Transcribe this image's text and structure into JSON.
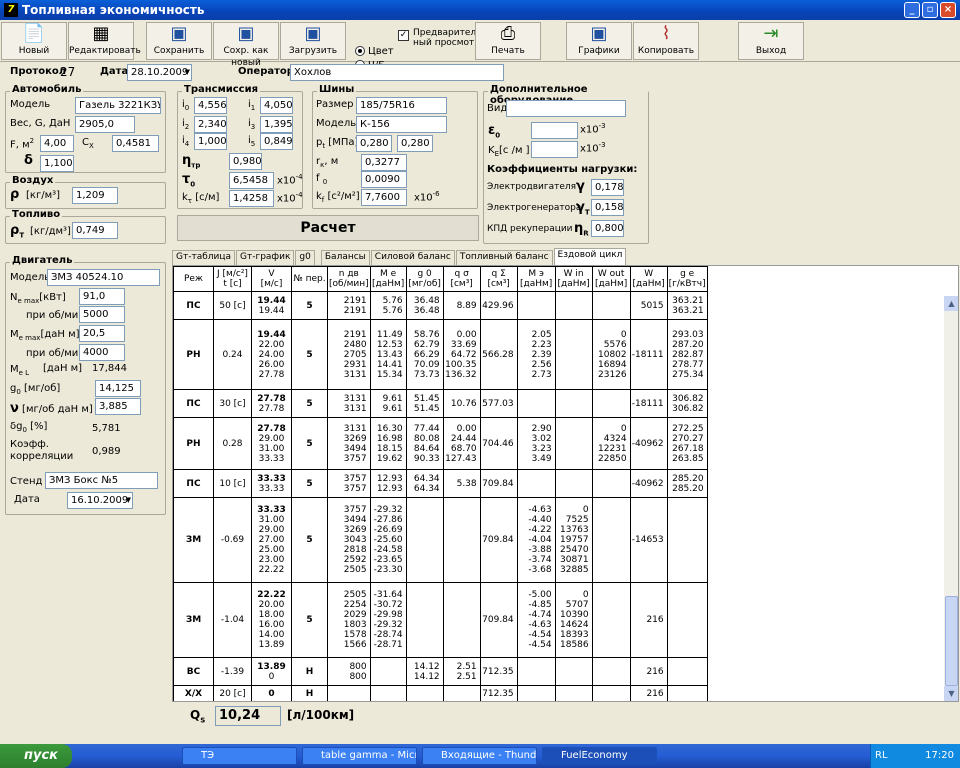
{
  "window": {
    "title": "Топливная экономичность"
  },
  "toolbar": {
    "new": "Новый",
    "edit": "Редактировать",
    "save": "Сохранить",
    "save_as": "Сохр. как новый",
    "load": "Загрузить",
    "color": "Цвет",
    "bw": "Ч/Б",
    "preview1": "Предваритель",
    "preview2": "ный просмотр",
    "print": "Печать",
    "charts": "Графики",
    "copy": "Копировать",
    "exit": "Выход"
  },
  "header": {
    "protocol_label": "Протокол",
    "protocol_value": "27",
    "date_label": "Дата",
    "date_value": "28.10.2009",
    "operator_label": "Оператор",
    "operator_value": "Хохлов"
  },
  "car": {
    "title": "Автомобиль",
    "model_label": "Модель",
    "model": "Газель 3221КЗУ",
    "weight_label": "Вес, G, ДаН",
    "weight": "2905,0",
    "f_label": "F, м",
    "f_value": "4,00",
    "cx_label": "C",
    "cx_value": "0,4581",
    "delta_label": "δ",
    "delta_value": "1,100"
  },
  "air": {
    "title": "Воздух",
    "rho_label": "ρ",
    "unit": "[кг/м³]",
    "value": "1,209"
  },
  "fuel": {
    "title": "Топливо",
    "rho_label": "ρ",
    "unit": "[кг/дм³]",
    "value": "0,749"
  },
  "transmission": {
    "title": "Трансмиссия",
    "i0": "4,556",
    "i1": "4,050",
    "i2": "2,340",
    "i3": "1,395",
    "i4": "1,000",
    "i5": "0,849",
    "eta": "0,980",
    "tau0": "6,5458",
    "tau_unit": "x10",
    "tau_exp": "-4",
    "k_tau": "1,4258",
    "k_tau_unit": "[с/м]",
    "k_tau_exp": "-4"
  },
  "tires": {
    "title": "Шины",
    "size_label": "Размер",
    "size": "185/75R16",
    "model_label": "Модель",
    "model": "К-156",
    "p_label": "p",
    "p_unit": "[МПа]",
    "p1": "0,280",
    "p2": "0,280",
    "rk_label": "r",
    "rk_unit": ", м",
    "rk": "0,3277",
    "f0_label": "f",
    "f0": "0,0090",
    "kf_label": "k",
    "kf_unit": "[с²/м²]",
    "kf": "7,7600",
    "kf_exp": "x10",
    "kf_exp_pow": "-6"
  },
  "extra": {
    "title": "Дополнительное оборудование",
    "type_label": "Вид",
    "type_value": "",
    "eps_label": "ε",
    "eps_value": "",
    "eps_exp": "x10",
    "eps_pow": "-3",
    "ke_label": "K",
    "ke_unit": "[с /м ]",
    "ke_value": "",
    "ke_pow": "-3",
    "load_title": "Коэффициенты нагрузки:",
    "motor_label": "Электродвигателя",
    "motor_sym": "γ",
    "motor_value": "0,178",
    "gen_label": "Электрогенератора",
    "gen_sym": "γ",
    "gen_value": "0,158",
    "kpd_label": "КПД рекуперации",
    "kpd_sym": "η",
    "kpd_value": "0,800"
  },
  "calc_button": "Расчет",
  "engine": {
    "title": "Двигатель",
    "model_label": "Модель",
    "model": "ЗМЗ 40524.10",
    "ne_label": "N",
    "ne_unit": "[кВт]",
    "ne_value": "91,0",
    "rpm1_label": "при об/мин",
    "rpm1": "5000",
    "me_label": "M",
    "me_unit": "[даН м]",
    "me_value": "20,5",
    "rpm2_label": "при об/мин",
    "rpm2": "4000",
    "mel_label": "M",
    "mel_unit": "[даН м]",
    "mel_value": "17,844",
    "g0_label": "g",
    "g0_unit": "[мг/об]",
    "g0_value": "14,125",
    "nu_label": "ν",
    "nu_unit": "[мг/об даН м]",
    "nu_value": "3,885",
    "dg0_label": "δg",
    "dg0_unit": "[%]",
    "dg0_value": "5,781",
    "corr_label1": "Коэфф.",
    "corr_label2": "корреляции",
    "corr_value": "0,989",
    "stand_label": "Стенд",
    "stand_value": "ЗМЗ Бокс №5",
    "date_label": "Дата",
    "date_value": "16.10.2009"
  },
  "tabs": [
    "Gт-таблица",
    "Gт-график",
    "g0",
    "Балансы",
    "Силовой баланс",
    "Топливный баланс",
    "Ездовой цикл"
  ],
  "table": {
    "headers": [
      [
        "Реж",
        ""
      ],
      [
        "J [м/с²]",
        "t [с]"
      ],
      [
        "V",
        "[м/с]"
      ],
      [
        "№ пер.",
        ""
      ],
      [
        "n дв",
        "[об/мин]"
      ],
      [
        "M e",
        "[даНм]"
      ],
      [
        "g 0",
        "[мг/об]"
      ],
      [
        "q σ",
        "[см³]"
      ],
      [
        "q Σ",
        "[см³]"
      ],
      [
        "M э",
        "[даНм]"
      ],
      [
        "W in",
        "[даНм]"
      ],
      [
        "W out",
        "[даНм]"
      ],
      [
        "W",
        "[даНм]"
      ],
      [
        "g e",
        "[г/кВтч]"
      ]
    ],
    "rows": [
      {
        "mode": "ПС",
        "j": "50 [с]",
        "v": [
          "19.44",
          "19.44"
        ],
        "gear": "5",
        "n": [
          "2191",
          "2191"
        ],
        "me": [
          "5.76",
          "5.76"
        ],
        "g0": [
          "36.48",
          "36.48"
        ],
        "qs": [
          "",
          "8.89"
        ],
        "qsum": [
          "",
          "429.96"
        ],
        "mz": [],
        "win": [],
        "wout": [],
        "w": [
          "",
          "5015"
        ],
        "ge": [
          "363.21",
          "363.21"
        ]
      },
      {
        "mode": "РН",
        "j": "0.24",
        "v": [
          "19.44",
          "22.00",
          "24.00",
          "26.00",
          "27.78"
        ],
        "gear": "5",
        "n": [
          "2191",
          "2480",
          "2705",
          "2931",
          "3131"
        ],
        "me": [
          "11.49",
          "12.53",
          "13.43",
          "14.41",
          "15.34"
        ],
        "g0": [
          "58.76",
          "62.79",
          "66.29",
          "70.09",
          "73.73"
        ],
        "qs": [
          "0.00",
          "33.69",
          "64.72",
          "100.35",
          "136.32"
        ],
        "qsum": [
          "",
          "",
          "",
          "",
          "566.28"
        ],
        "mz": [
          "2.05",
          "2.23",
          "2.39",
          "2.56",
          "2.73"
        ],
        "win": [],
        "wout": [
          "0",
          "5576",
          "10802",
          "16894",
          "23126"
        ],
        "w": [
          "",
          "",
          "",
          "",
          "-18111"
        ],
        "ge": [
          "293.03",
          "287.20",
          "282.87",
          "278.77",
          "275.34"
        ]
      },
      {
        "mode": "ПС",
        "j": "30 [с]",
        "v": [
          "27.78",
          "27.78"
        ],
        "gear": "5",
        "n": [
          "3131",
          "3131"
        ],
        "me": [
          "9.61",
          "9.61"
        ],
        "g0": [
          "51.45",
          "51.45"
        ],
        "qs": [
          "",
          "10.76"
        ],
        "qsum": [
          "",
          "577.03"
        ],
        "mz": [],
        "win": [],
        "wout": [],
        "w": [
          "",
          "-18111"
        ],
        "ge": [
          "306.82",
          "306.82"
        ]
      },
      {
        "mode": "РН",
        "j": "0.28",
        "v": [
          "27.78",
          "29.00",
          "31.00",
          "33.33"
        ],
        "gear": "5",
        "n": [
          "3131",
          "3269",
          "3494",
          "3757"
        ],
        "me": [
          "16.30",
          "16.98",
          "18.15",
          "19.62"
        ],
        "g0": [
          "77.44",
          "80.08",
          "84.64",
          "90.33"
        ],
        "qs": [
          "0.00",
          "24.44",
          "68.70",
          "127.43"
        ],
        "qsum": [
          "",
          "",
          "",
          "704.46"
        ],
        "mz": [
          "2.90",
          "3.02",
          "3.23",
          "3.49"
        ],
        "win": [],
        "wout": [
          "0",
          "4324",
          "12231",
          "22850"
        ],
        "w": [
          "",
          "",
          "",
          "-40962"
        ],
        "ge": [
          "272.25",
          "270.27",
          "267.18",
          "263.85"
        ]
      },
      {
        "mode": "ПС",
        "j": "10 [с]",
        "v": [
          "33.33",
          "33.33"
        ],
        "gear": "5",
        "n": [
          "3757",
          "3757"
        ],
        "me": [
          "12.93",
          "12.93"
        ],
        "g0": [
          "64.34",
          "64.34"
        ],
        "qs": [
          "",
          "5.38"
        ],
        "qsum": [
          "",
          "709.84"
        ],
        "mz": [],
        "win": [],
        "wout": [],
        "w": [
          "",
          "-40962"
        ],
        "ge": [
          "285.20",
          "285.20"
        ]
      },
      {
        "mode": "ЗМ",
        "j": "-0.69",
        "v": [
          "33.33",
          "31.00",
          "29.00",
          "27.00",
          "25.00",
          "23.00",
          "22.22"
        ],
        "gear": "5",
        "n": [
          "3757",
          "3494",
          "3269",
          "3043",
          "2818",
          "2592",
          "2505"
        ],
        "me": [
          "-29.32",
          "-27.86",
          "-26.69",
          "-25.60",
          "-24.58",
          "-23.65",
          "-23.30"
        ],
        "g0": [],
        "qs": [],
        "qsum": [
          "",
          "",
          "",
          "",
          "",
          "",
          "709.84"
        ],
        "mz": [
          "-4.63",
          "-4.40",
          "-4.22",
          "-4.04",
          "-3.88",
          "-3.74",
          "-3.68"
        ],
        "win": [
          "0",
          "7525",
          "13763",
          "19757",
          "25470",
          "30871",
          "32885"
        ],
        "wout": [],
        "w": [
          "",
          "",
          "",
          "",
          "",
          "",
          "-14653"
        ],
        "ge": []
      },
      {
        "mode": "ЗМ",
        "j": "-1.04",
        "v": [
          "22.22",
          "20.00",
          "18.00",
          "16.00",
          "14.00",
          "13.89"
        ],
        "gear": "5",
        "n": [
          "2505",
          "2254",
          "2029",
          "1803",
          "1578",
          "1566"
        ],
        "me": [
          "-31.64",
          "-30.72",
          "-29.98",
          "-29.32",
          "-28.74",
          "-28.71"
        ],
        "g0": [],
        "qs": [],
        "qsum": [
          "",
          "",
          "",
          "",
          "",
          "709.84"
        ],
        "mz": [
          "-5.00",
          "-4.85",
          "-4.74",
          "-4.63",
          "-4.54",
          "-4.54"
        ],
        "win": [
          "0",
          "5707",
          "10390",
          "14624",
          "18393",
          "18586"
        ],
        "wout": [],
        "w": [
          "",
          "",
          "",
          "",
          "",
          "216"
        ],
        "ge": []
      },
      {
        "mode": "ВС",
        "j": "-1.39",
        "v": [
          "13.89",
          "0"
        ],
        "gear": "Н",
        "n": [
          "800",
          "800"
        ],
        "me": [],
        "g0": [
          "14.12",
          "14.12"
        ],
        "qs": [
          "2.51",
          "2.51"
        ],
        "qsum": [
          "712.35",
          ""
        ],
        "mz": [],
        "win": [],
        "wout": [],
        "w": [
          "",
          "216"
        ],
        "ge": []
      },
      {
        "mode": "Х/Х",
        "j": "20 [с]",
        "v": [
          "0"
        ],
        "gear": "Н",
        "n": [],
        "me": [],
        "g0": [],
        "qs": [],
        "qsum": [
          "712.35"
        ],
        "mz": [],
        "win": [],
        "wout": [],
        "w": [
          "216"
        ],
        "ge": []
      }
    ]
  },
  "result": {
    "label": "Q",
    "label_sub": "S",
    "value": "10,24",
    "unit": "[л/100км]"
  },
  "taskbar": {
    "start": "пуск",
    "items": [
      "ТЭ",
      "table gamma - Micros...",
      "Входящие - Thunder...",
      "FuelEconomy"
    ],
    "lang": "RL",
    "clock": "17:20"
  }
}
